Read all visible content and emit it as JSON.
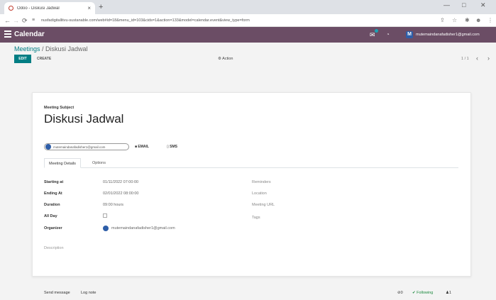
{
  "browser": {
    "tab_title": "Odoo - Diskusi Jadwal",
    "tab_close": "×",
    "new_tab": "+",
    "url": "nusfadigitallitvu-sustanable.com/web#id=18&menu_id=103&cids=1&action=133&model=calendar.event&view_type=form",
    "win_min": "—",
    "win_max": "□",
    "win_close": "✕"
  },
  "appbar": {
    "title": "Calendar",
    "user_initial": "M",
    "user_email": "mutemaindanafadisher1@gmail.com",
    "color": "#6b4d65"
  },
  "control_panel": {
    "breadcrumb_parent": "Meetings",
    "breadcrumb_sep": " / ",
    "breadcrumb_current": "Diskusi Jadwal",
    "edit_label": "EDIT",
    "create_label": "CREATE",
    "action_label": "⚙ Action",
    "pager": "1 / 1"
  },
  "form": {
    "subject_label": "Meeting Subject",
    "subject": "Diskusi Jadwal",
    "attendee": "mutemaindanafadisher1@gmail.com",
    "email_btn": "EMAIL",
    "sms_btn": "SMS",
    "tabs": [
      {
        "label": "Meeting Details",
        "active": true
      },
      {
        "label": "Options",
        "active": false
      }
    ],
    "fields_left": [
      {
        "label": "Starting at",
        "value": "01/11/2022 07:00:00"
      },
      {
        "label": "Ending At",
        "value": "02/01/2022 08:00:00"
      },
      {
        "label": "Duration",
        "value": "09:00 hours"
      },
      {
        "label": "All Day",
        "value": ""
      },
      {
        "label": "Organizer",
        "value": "mutemaindanafadisher1@gmail.com"
      }
    ],
    "fields_right": [
      {
        "label": "Reminders"
      },
      {
        "label": "Location"
      },
      {
        "label": "Meeting URL"
      },
      {
        "label": "Tags"
      }
    ],
    "description_placeholder": "Description"
  },
  "chatter": {
    "send_message": "Send message",
    "log_note": "Log note",
    "attachments": "0",
    "following": "✔ Following",
    "followers": "1"
  },
  "colors": {
    "accent": "#017e84",
    "appbar": "#6b4d65"
  }
}
